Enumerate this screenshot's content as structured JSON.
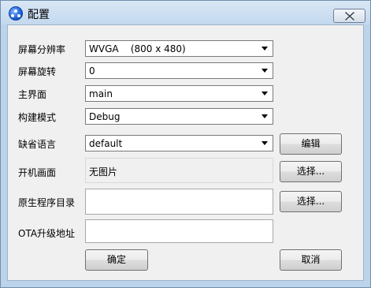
{
  "window": {
    "title": "配置",
    "close_icon": "close-icon",
    "app_icon": "app-icon"
  },
  "form": {
    "resolution": {
      "label": "屏幕分辨率",
      "value": "WVGA    (800 x 480)"
    },
    "rotation": {
      "label": "屏幕旋转",
      "value": "0"
    },
    "main_ui": {
      "label": "主界面",
      "value": "main"
    },
    "build_mode": {
      "label": "构建模式",
      "value": "Debug"
    },
    "language": {
      "label": "缺省语言",
      "value": "default",
      "button": "编辑"
    },
    "boot_image": {
      "label": "开机画面",
      "value": "无图片",
      "button": "选择..."
    },
    "native_dir": {
      "label": "原生程序目录",
      "value": "",
      "button": "选择..."
    },
    "ota_url": {
      "label": "OTA升级地址",
      "value": ""
    }
  },
  "buttons": {
    "ok": "确定",
    "cancel": "取消"
  }
}
